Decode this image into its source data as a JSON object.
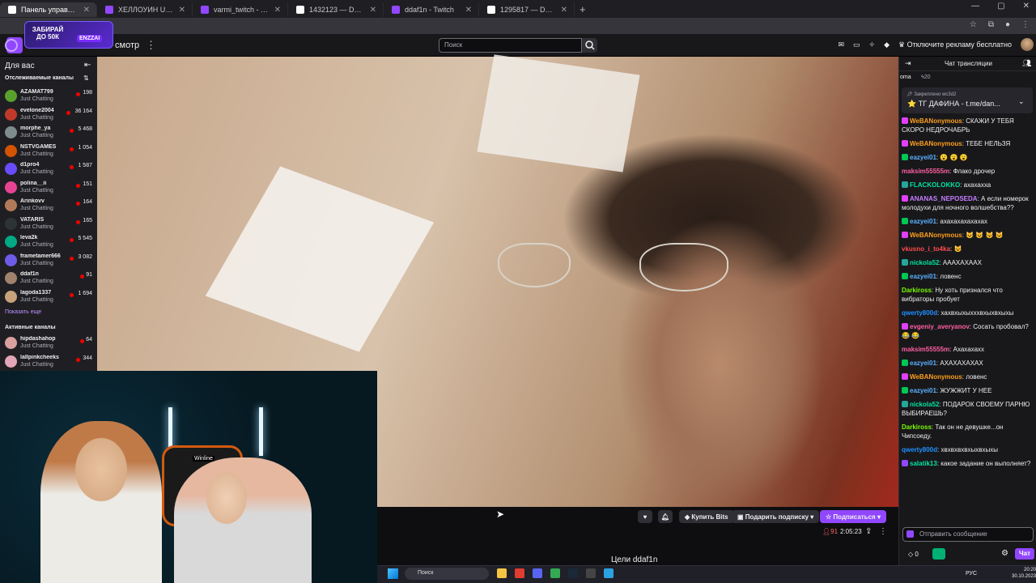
{
  "browser": {
    "tabs": [
      {
        "title": "Панель управления - DonatePay",
        "favicon_color": "#ffffff",
        "active": true
      },
      {
        "title": "ХЕЛЛОУИН UP-X LIVE - Twitch",
        "favicon_color": "#9147ff",
        "active": false
      },
      {
        "title": "varmi_twitch - Twitch",
        "favicon_color": "#9147ff",
        "active": false
      },
      {
        "title": "1432123 — DonatePay",
        "favicon_color": "#ffffff",
        "active": false
      },
      {
        "title": "ddaf1n - Twitch",
        "favicon_color": "#9147ff",
        "active": false
      },
      {
        "title": "1295817 — DonatePay",
        "favicon_color": "#ffffff",
        "active": false
      }
    ],
    "new_tab_icon": "plus-icon"
  },
  "promo": {
    "text": "ЗАБИРАЙ ДО 50К",
    "badge": "ENZZAI"
  },
  "topnav": {
    "browse_label": "смотр",
    "more_icon": "⋮",
    "search_placeholder": "Поиск",
    "ad_free_label": "Отключите рекламу бесплатно"
  },
  "sidebar": {
    "title": "Для вас",
    "followed_header": "Отслеживаемые каналы",
    "show_more": "Показать еще",
    "active_header": "Активные каналы",
    "followed": [
      {
        "name": "AZAMAT799",
        "game": "Just Chatting",
        "viewers": "198",
        "avatar": "#5aa02c"
      },
      {
        "name": "evelone2004",
        "game": "Just Chatting",
        "viewers": "36 164",
        "avatar": "#c0392b"
      },
      {
        "name": "morphe_ya",
        "game": "Just Chatting",
        "viewers": "5 468",
        "avatar": "#7f8c8d"
      },
      {
        "name": "NSTVGAMES",
        "game": "Just Chatting",
        "viewers": "1 054",
        "avatar": "#d35400"
      },
      {
        "name": "d1pro4",
        "game": "Just Chatting",
        "viewers": "1 587",
        "avatar": "#6a4cff"
      },
      {
        "name": "polina__ii",
        "game": "Just Chatting",
        "viewers": "151",
        "avatar": "#e84393"
      },
      {
        "name": "Arinkovv",
        "game": "Just Chatting",
        "viewers": "164",
        "avatar": "#b07a5a"
      },
      {
        "name": "VATARIS",
        "game": "Just Chatting",
        "viewers": "165",
        "avatar": "#2d3436"
      },
      {
        "name": "leva2k",
        "game": "Just Chatting",
        "viewers": "5 545",
        "avatar": "#00a884"
      },
      {
        "name": "frametamer666",
        "game": "Just Chatting",
        "viewers": "3 082",
        "avatar": "#6c5ce7"
      },
      {
        "name": "ddaf1n",
        "game": "Just Chatting",
        "viewers": "91",
        "avatar": "#a0826d"
      },
      {
        "name": "lagoda1337",
        "game": "Just Chatting",
        "viewers": "1 694",
        "avatar": "#c8a27a"
      }
    ],
    "active": [
      {
        "name": "hipdashahop",
        "game": "Just Chatting",
        "viewers": "64",
        "avatar": "#d9a0a0"
      },
      {
        "name": "lallpinkcheeks",
        "game": "Just Chatting",
        "viewers": "344",
        "avatar": "#e3a6b8"
      }
    ]
  },
  "webcam": {
    "chair_brand": "Winline"
  },
  "player": {
    "bits_label": "Купить Bits",
    "gift_label": "Подарить подписку",
    "subscribe_label": "Подписаться",
    "viewers": "91",
    "uptime": "2:05:23",
    "goals_label": "Цели ddaf1n"
  },
  "chat": {
    "title": "Чат трансляции",
    "sub_left": "oma",
    "sub_right": "20",
    "pinned_label": "Закреплено",
    "pinned_by": "wc3d2",
    "pinned_text": "⭐ ТГ ДАФИНА - t.me/dan...",
    "input_placeholder": "Отправить сообщение",
    "points": "0",
    "send_label": "Чат",
    "messages": [
      {
        "user": "WeBANonymous",
        "color": "#ff9f1c",
        "text": ": СКАЖИ У ТЕБЯ СКОРО НЕДРОЧАБРЬ",
        "badge": "#e040fb"
      },
      {
        "user": "WeBANonymous",
        "color": "#ff9f1c",
        "text": ": ТЕБЕ НЕЛЬЗЯ",
        "badge": "#e040fb"
      },
      {
        "user": "eazyei01",
        "color": "#5ab0ff",
        "text": ": 😮 😮 😮",
        "badge": "#00c853"
      },
      {
        "user": "maksim55555m",
        "color": "#ff5fa2",
        "text": ": Флако дрочер",
        "badge": ""
      },
      {
        "user": "FLACKOLOKKO",
        "color": "#00e5a0",
        "text": ": ахахахха",
        "badge": "#26a69a"
      },
      {
        "user": "ANANAS_NEPOSEDA",
        "color": "#c77dff",
        "text": ": А если номерок молодухи для ночного волшебства??",
        "badge": "#e040fb"
      },
      {
        "user": "eazyei01",
        "color": "#5ab0ff",
        "text": ": ахахахахахахах",
        "badge": "#00c853"
      },
      {
        "user": "WeBANonymous",
        "color": "#ff9f1c",
        "text": ": 😺 😺 😺 😺",
        "badge": "#e040fb"
      },
      {
        "user": "vkusno_i_to4ka",
        "color": "#ff4d4d",
        "text": ": 😺",
        "badge": ""
      },
      {
        "user": "nickola52",
        "color": "#00e5a0",
        "text": ": АААХАХААХ",
        "badge": "#26a69a"
      },
      {
        "user": "eazyei01",
        "color": "#5ab0ff",
        "text": ": ловенс",
        "badge": "#00c853"
      },
      {
        "user": "Darkiross",
        "color": "#7cfc00",
        "text": ": Ну хоть признался что вибраторы пробует",
        "badge": ""
      },
      {
        "user": "qwerty800d",
        "color": "#1e90ff",
        "text": ": хахвхыхыхххвхыхвхыхы",
        "badge": ""
      },
      {
        "user": "evgeniy_averyanov",
        "color": "#ff5fa2",
        "text": ": Сосать пробовал? 😂 😂",
        "badge": "#e040fb"
      },
      {
        "user": "maksim55555m",
        "color": "#ff5fa2",
        "text": ": Ахахахахх",
        "badge": ""
      },
      {
        "user": "eazyei01",
        "color": "#5ab0ff",
        "text": ": АХАХАХАХАХ",
        "badge": "#00c853"
      },
      {
        "user": "WeBANonymous",
        "color": "#ff9f1c",
        "text": ": ловенс",
        "badge": "#e040fb"
      },
      {
        "user": "eazyei01",
        "color": "#5ab0ff",
        "text": ": ЖУЖЖИТ У НЕЕ",
        "badge": "#00c853"
      },
      {
        "user": "nickola52",
        "color": "#00e5a0",
        "text": ": ПОДАРОК СВОЕМУ ПАРНЮ ВЫБИРАЕШЬ?",
        "badge": "#26a69a"
      },
      {
        "user": "Darkiross",
        "color": "#7cfc00",
        "text": ": Так он не девушке...он Чипсоеду.",
        "badge": ""
      },
      {
        "user": "qwerty800d",
        "color": "#1e90ff",
        "text": ": хвхвхвхвхыхвхыхы",
        "badge": ""
      },
      {
        "user": "salatik13",
        "color": "#00e5a0",
        "text": ": какое задание он выполняет?",
        "badge": "#9147ff"
      }
    ]
  },
  "taskbar": {
    "search_placeholder": "Поиск",
    "lang": "РУС",
    "time": "20:20",
    "date": "30.10.2023",
    "apps": [
      {
        "name": "file-explorer-icon",
        "color": "#f4c542"
      },
      {
        "name": "shield-app-icon",
        "color": "#e03c31"
      },
      {
        "name": "discord-icon",
        "color": "#5865f2"
      },
      {
        "name": "chrome-icon",
        "color": "#34a853"
      },
      {
        "name": "steam-icon",
        "color": "#1b2838"
      },
      {
        "name": "obs-icon",
        "color": "#444"
      },
      {
        "name": "telegram-icon",
        "color": "#2aa3e0"
      }
    ]
  }
}
